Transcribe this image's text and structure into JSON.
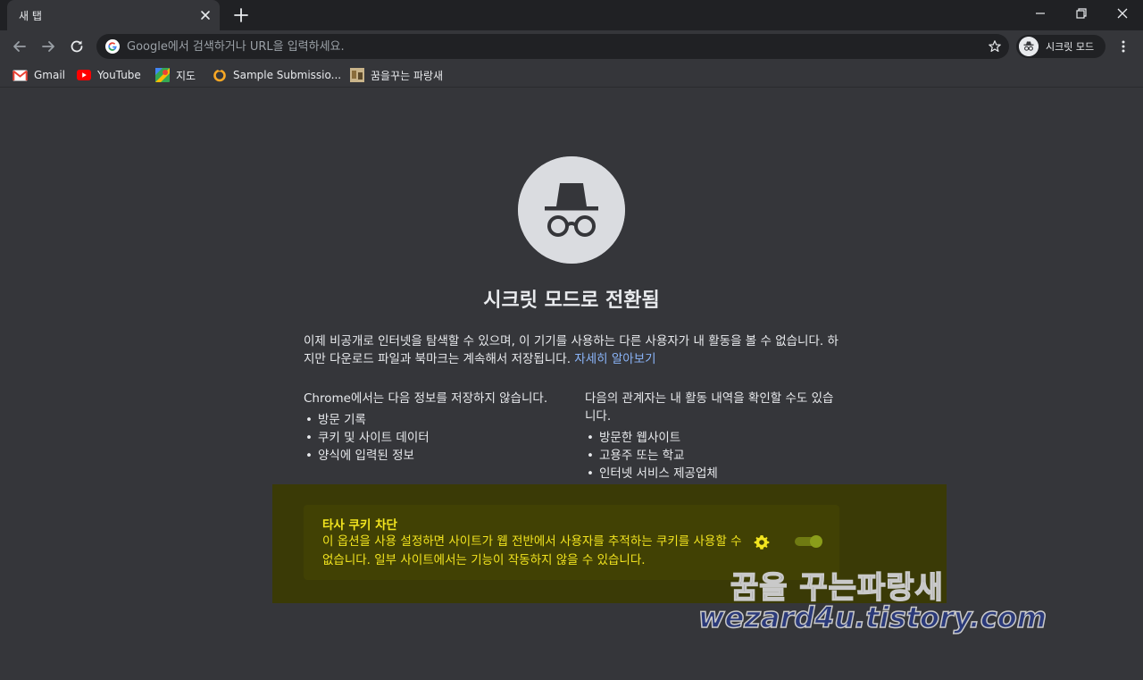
{
  "tab": {
    "title": "새 탭"
  },
  "omnibox": {
    "placeholder": "Google에서 검색하거나 URL을 입력하세요."
  },
  "profile": {
    "label": "시크릿 모드"
  },
  "bookmarks": [
    {
      "label": "Gmail",
      "icon": "gmail-icon"
    },
    {
      "label": "YouTube",
      "icon": "youtube-icon"
    },
    {
      "label": "지도",
      "icon": "maps-icon"
    },
    {
      "label": "Sample Submissio...",
      "icon": "circle-icon"
    },
    {
      "label": "꿈을꾸는 파랑새",
      "icon": "thumbnail-icon"
    }
  ],
  "main": {
    "title": "시크릿 모드로 전환됨",
    "intro": "이제 비공개로 인터넷을 탐색할 수 있으며, 이 기기를 사용하는 다른 사용자가 내 활동을 볼 수 없습니다. 하지만 다운로드 파일과 북마크는 계속해서 저장됩니다.",
    "learn_more": "자세히 알아보기",
    "not_saved": {
      "title": "Chrome에서는 다음 정보를 저장하지 않습니다.",
      "items": [
        "방문 기록",
        "쿠키 및 사이트 데이터",
        "양식에 입력된 정보"
      ]
    },
    "visible_to": {
      "title": "다음의 관계자는 내 활동 내역을 확인할 수도 있습니다.",
      "items": [
        "방문한 웹사이트",
        "고용주 또는 학교",
        "인터넷 서비스 제공업체"
      ]
    }
  },
  "cookies": {
    "title": "타사 쿠키 차단",
    "description": "이 옵션을 사용 설정하면 사이트가 웹 전반에서 사용자를 추적하는 쿠키를 사용할 수 없습니다. 일부 사이트에서는 기능이 작동하지 않을 수 있습니다.",
    "toggle_on": true
  },
  "watermark": {
    "line1": "꿈을 꾸는파랑새",
    "line2": "wezard4u.tistory.com"
  },
  "colors": {
    "background": "#35363a",
    "tabstrip": "#202124",
    "link": "#8ab4f8",
    "highlight_text": "#f2e41f"
  }
}
